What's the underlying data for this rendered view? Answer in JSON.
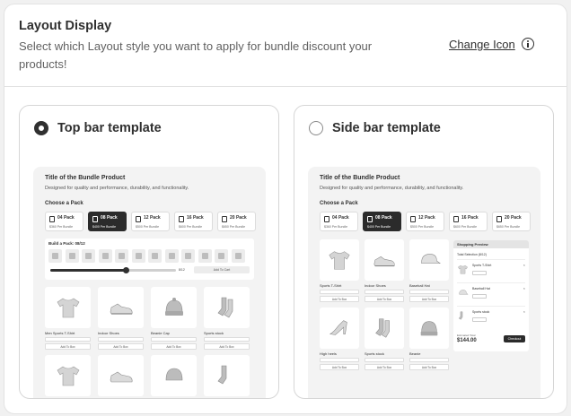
{
  "header": {
    "title": "Layout Display",
    "description": "Select which Layout style you want to apply for bundle discount your products!",
    "change_icon_label": "Change Icon"
  },
  "options": [
    {
      "label": "Top bar template",
      "selected": true
    },
    {
      "label": "Side bar template",
      "selected": false
    }
  ],
  "preview": {
    "title": "Title of the Bundle Product",
    "subtitle": "Designed for quality and performance, durability, and functionality.",
    "choose_pack": "Choose a Pack",
    "packs": [
      {
        "label": "04 Pack",
        "sub": "$360 Per Bundle"
      },
      {
        "label": "08 Pack",
        "sub": "$400 Per Bundle"
      },
      {
        "label": "12 Pack",
        "sub": "$500 Per Bundle"
      },
      {
        "label": "16 Pack",
        "sub": "$600 Per Bundle"
      },
      {
        "label": "20 Pack",
        "sub": "$650 Per Bundle"
      }
    ],
    "active_pack": 1,
    "builder_title": "Build a Pack: 08/12",
    "builder_progress": 0.6,
    "builder_count": "8/12",
    "add_to_cart": "Add To Cart",
    "add_to_box": "Add To Box",
    "top_products": [
      "Men Sports T-Shirt",
      "Indoor Shoes",
      "Beanie Cap",
      "Sports stock"
    ],
    "side_products": [
      "Sports T-Shirt",
      "Indoor Shoes",
      "Baseball Hat",
      "High heels",
      "Sports stock",
      "Beanie"
    ],
    "cart": {
      "title": "Shopping Preview",
      "subtitle": "Total Selection (8/12)",
      "items": [
        "Sports T-Shirt",
        "Baseball Hat",
        "Sports stock"
      ],
      "estimated_label": "Estimated Total",
      "price": "$144.00",
      "checkout": "Checkout"
    }
  }
}
